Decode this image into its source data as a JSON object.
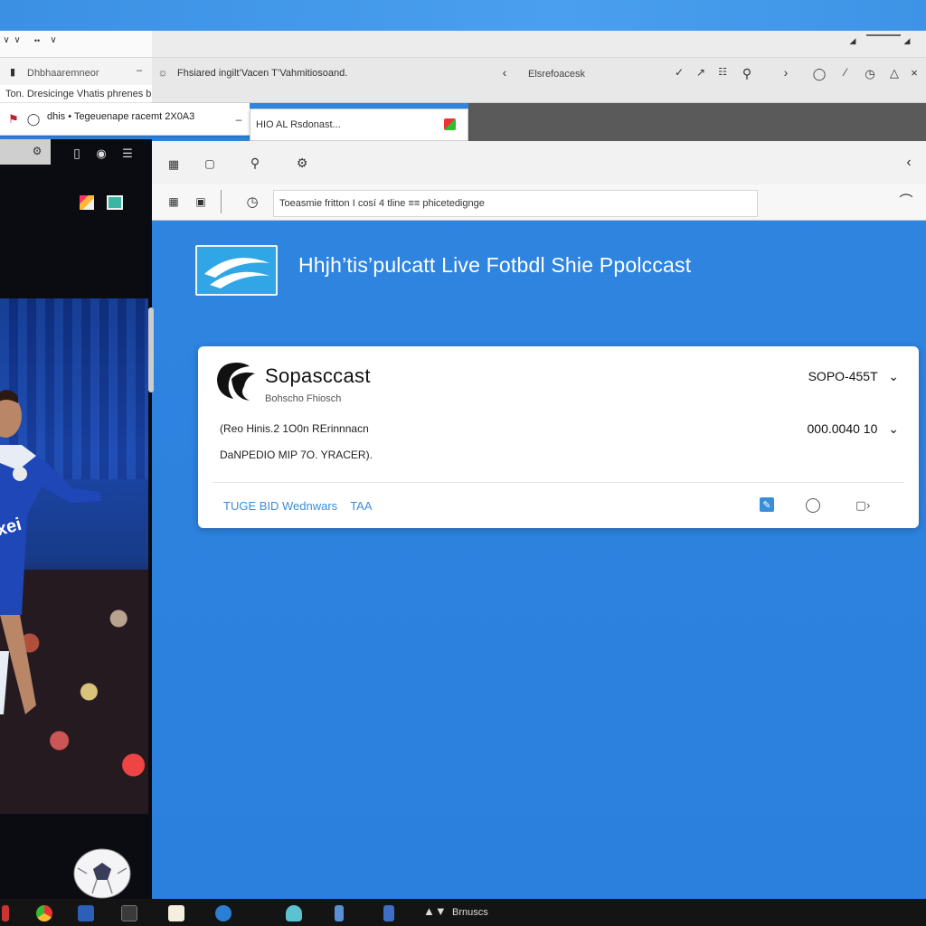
{
  "popup": {
    "tab_label": "Dhbhaaremneor",
    "row1": "Ton. Dresicinge  Vhatis phrenes bpoick",
    "row2": "dhis  •  Tegeuenape racemt 2X0A3",
    "url_popup": "HIO AL Rsdonast..."
  },
  "browser": {
    "tab_title": "Fhsiared ingilt’Vacen T’Vahmitiosoand.",
    "tab_title2": "Elsrefoacesk",
    "address": "Toeasmie fritton  I cosí  4 tline  ≡≡ phicetedignge"
  },
  "hero": {
    "title": "Hhjh’tis’pulcatt Live Fotbdl Shie Ppolccast"
  },
  "card": {
    "brand": "Sopasccast",
    "brand_sub": "Bohscho Fhiosch",
    "right1": "SOPO-455T",
    "line1": "(Reo Hinis.2  1O0n  RErinnnacn",
    "line2": "DaNPEDIO MIP  7O.  YRACER).",
    "right2": "000.0040 10",
    "footer_link1": "TUGE BID Wednwars",
    "footer_link2": "TAA"
  },
  "taskbar": {
    "label": "Brnuscs"
  },
  "colors": {
    "background": "#2b7fdd",
    "card": "#ffffff",
    "accent": "#3a8ed8",
    "hero_logo": "#30a6e6"
  }
}
